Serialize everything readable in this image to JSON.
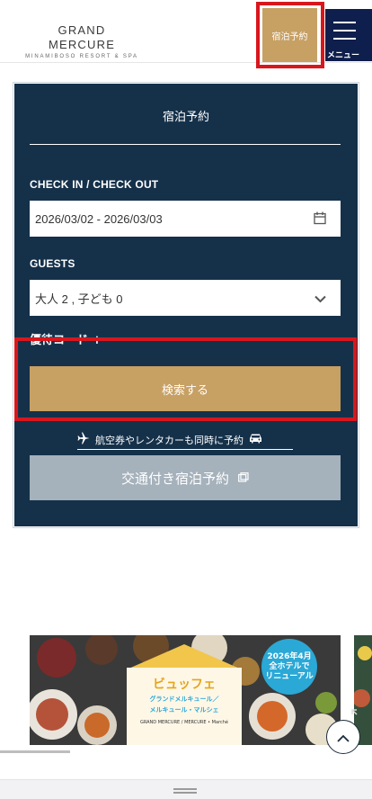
{
  "header": {
    "logo_main": "GRAND MERCURE",
    "logo_sub": "MINAMIBOSO RESORT & SPA",
    "reserve_label": "宿泊予約",
    "menu_label": "メニュー"
  },
  "booking": {
    "title": "宿泊予約",
    "checkin_label": "CHECK IN / CHECK OUT",
    "dates_value": "2026/03/02 - 2026/03/03",
    "guests_label": "GUESTS",
    "guests_value": "大人 2 , 子ども 0",
    "promo_label": "優待コード +",
    "search_label": "検索する",
    "air_link_label": "航空券やレンタカーも同時に予約",
    "transport_label": "交通付き宿泊予約"
  },
  "banner": {
    "badge_line1": "2026年4月",
    "badge_line2": "全ホテルで",
    "badge_line3": "リニューアル",
    "main": "ビュッフェ",
    "line1": "グランドメルキュール／",
    "line2": "メルキュール・マルシェ",
    "line3": "GRAND MERCURE / MERCURE • Marché"
  },
  "colors": {
    "panel": "#15314a",
    "gold": "#c7a064",
    "highlight": "#d8171d",
    "menu": "#0f1f4d",
    "transport": "#a5b1bb"
  },
  "icons": [
    "calendar-icon",
    "chevron-down-icon",
    "airplane-icon",
    "car-icon",
    "external-link-icon",
    "chevron-up-icon",
    "expand-icon"
  ]
}
